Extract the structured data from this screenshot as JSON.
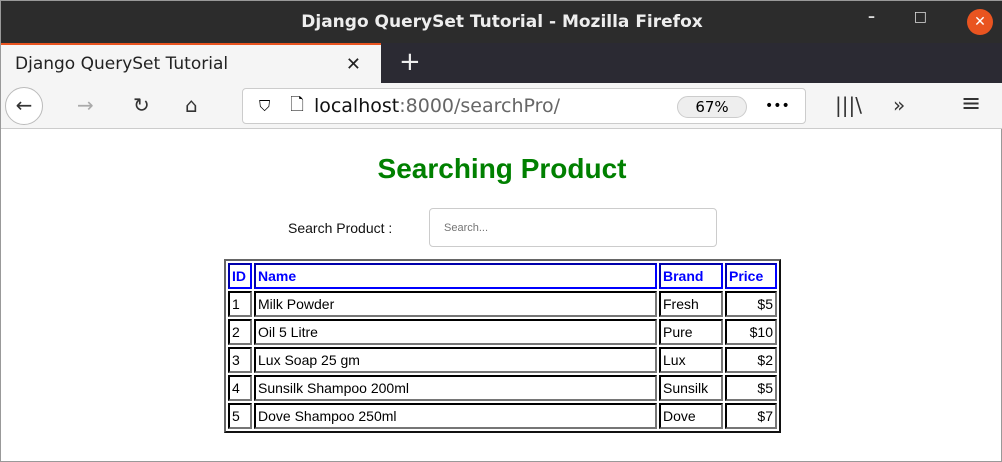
{
  "window": {
    "title": "Django QuerySet Tutorial - Mozilla Firefox",
    "minimize": "–",
    "maximize": "□",
    "close": "✕"
  },
  "tab": {
    "label": "Django QuerySet Tutorial",
    "close": "✕",
    "new": "+"
  },
  "nav": {
    "back": "←",
    "forward": "→",
    "reload": "↻",
    "home": "⌂",
    "shield": "⛉",
    "page": "🗋",
    "host": "localhost",
    "path": ":8000/searchPro/",
    "zoom": "67%",
    "more": "•••",
    "library": "|||\\",
    "overflow": "»",
    "menu": "≡"
  },
  "page": {
    "title": "Searching Product",
    "search_label": "Search Product :",
    "search_placeholder": "Search..."
  },
  "table": {
    "headers": [
      "ID",
      "Name",
      "Brand",
      "Price"
    ],
    "rows": [
      [
        "1",
        "Milk Powder",
        "Fresh",
        "$5"
      ],
      [
        "2",
        "Oil 5 Litre",
        "Pure",
        "$10"
      ],
      [
        "3",
        "Lux Soap 25 gm",
        "Lux",
        "$2"
      ],
      [
        "4",
        "Sunsilk Shampoo 200ml",
        "Sunsilk",
        "$5"
      ],
      [
        "5",
        "Dove Shampoo 250ml",
        "Dove",
        "$7"
      ]
    ]
  }
}
